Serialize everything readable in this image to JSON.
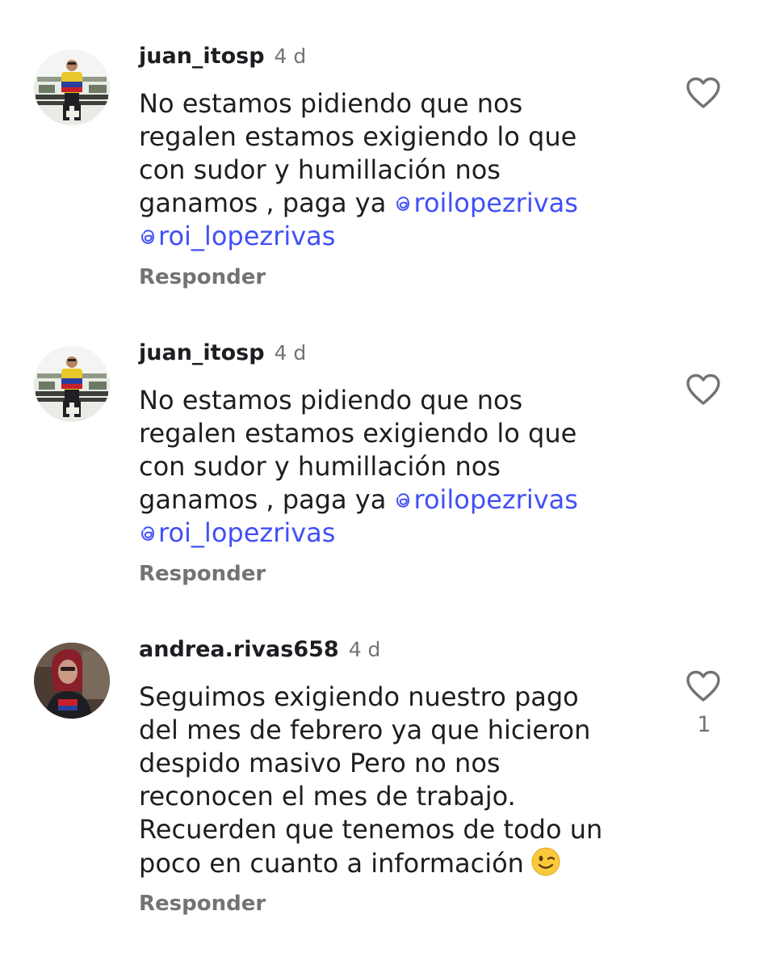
{
  "comments": [
    {
      "username": "juan_itosp",
      "time": "4 d",
      "lines": [
        "No estamos pidiendo que nos",
        "regalen estamos exigiendo lo que",
        "con sudor y humillación nos",
        "ganamos , paga ya "
      ],
      "mention1": "roilopezrivas",
      "mention2": "roi_lopezrivas",
      "reply": "Responder",
      "avatar_icon": "person-on-bench-avatar"
    },
    {
      "username": "juan_itosp",
      "time": "4 d",
      "lines": [
        "No estamos pidiendo que nos",
        "regalen estamos exigiendo lo que",
        "con sudor y humillación nos",
        "ganamos , paga ya "
      ],
      "mention1": "roilopezrivas",
      "mention2": "roi_lopezrivas",
      "reply": "Responder",
      "avatar_icon": "person-on-bench-avatar"
    },
    {
      "username": "andrea.rivas658",
      "time": "4 d",
      "lines": [
        "Seguimos exigiendo nuestro pago",
        "del mes de febrero ya que hicieron",
        "despido masivo Pero no nos",
        "reconocen el mes de trabajo.",
        "Recuerden que tenemos de todo un",
        "poco en cuanto a información"
      ],
      "emoji": "winking-face-emoji",
      "like_count": "1",
      "reply": "Responder",
      "avatar_icon": "woman-selfie-avatar"
    }
  ],
  "colors": {
    "text": "#1c1e21",
    "muted": "#737373",
    "mention": "#4150f7",
    "background": "#ffffff"
  },
  "icons": {
    "like": "heart-outline-icon",
    "mention_prefix": "threads-at-icon"
  }
}
